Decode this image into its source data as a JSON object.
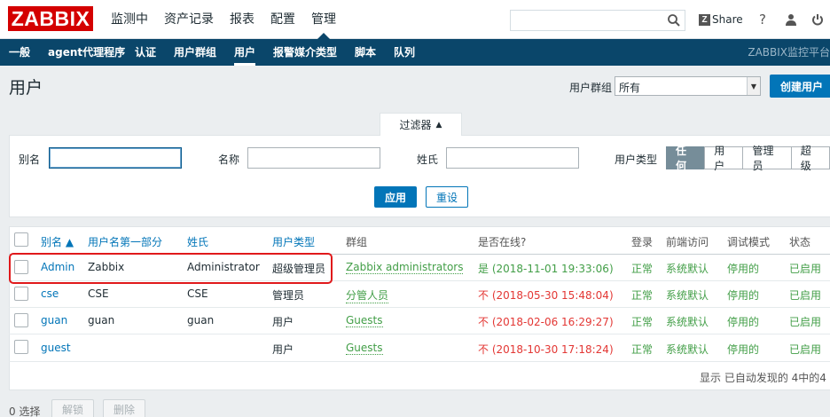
{
  "app": {
    "logo": "ZABBIX",
    "main_menu": [
      "监测中",
      "资产记录",
      "报表",
      "配置",
      "管理"
    ],
    "share_label": "Share",
    "help_glyph": "?"
  },
  "subnav": {
    "items": [
      "一般",
      "agent代理程序",
      "认证",
      "用户群组",
      "用户",
      "报警媒介类型",
      "脚本",
      "队列"
    ],
    "brand": "ZABBIX监控平台"
  },
  "page": {
    "title": "用户",
    "group_label": "用户群组",
    "group_value": "所有",
    "create_button": "创建用户"
  },
  "filter": {
    "tab_label": "过滤器",
    "alias_label": "别名",
    "alias_value": "",
    "name_label": "名称",
    "name_value": "",
    "surname_label": "姓氏",
    "surname_value": "",
    "type_label": "用户类型",
    "type_options": [
      "任何",
      "用户",
      "管理员",
      "超级"
    ],
    "apply_label": "应用",
    "reset_label": "重设"
  },
  "table": {
    "headers": {
      "alias": "别名 ▲",
      "name": "用户名第一部分",
      "surname": "姓氏",
      "type": "用户类型",
      "groups": "群组",
      "online": "是否在线?",
      "login": "登录",
      "frontend": "前端访问",
      "debug": "调试模式",
      "status": "状态"
    },
    "rows": [
      {
        "alias": "Admin",
        "name": "Zabbix",
        "surname": "Administrator",
        "type": "超级管理员",
        "groups": "Zabbix administrators",
        "online": "是 (2018-11-01 19:33:06)",
        "login": "正常",
        "frontend": "系统默认",
        "debug": "停用的",
        "status": "已启用"
      },
      {
        "alias": "cse",
        "name": "CSE",
        "surname": "CSE",
        "type": "管理员",
        "groups": "分管人员",
        "online": "不 (2018-05-30 15:48:04)",
        "login": "正常",
        "frontend": "系统默认",
        "debug": "停用的",
        "status": "已启用"
      },
      {
        "alias": "guan",
        "name": "guan",
        "surname": "guan",
        "type": "用户",
        "groups": "Guests",
        "online": "不 (2018-02-06 16:29:27)",
        "login": "正常",
        "frontend": "系统默认",
        "debug": "停用的",
        "status": "已启用"
      },
      {
        "alias": "guest",
        "name": "",
        "surname": "",
        "type": "用户",
        "groups": "Guests",
        "online": "不 (2018-10-30 17:18:24)",
        "login": "正常",
        "frontend": "系统默认",
        "debug": "停用的",
        "status": "已启用"
      }
    ],
    "footer": "显示 已自动发现的 4中的4"
  },
  "bottom": {
    "selected": "0 选择",
    "unlock": "解锁",
    "delete": "删除"
  },
  "colors": {
    "brand_red": "#d40000",
    "nav_blue": "#0a466a",
    "link_blue": "#0275b8",
    "ok_green": "#429e47",
    "offline_red": "#e33734"
  }
}
